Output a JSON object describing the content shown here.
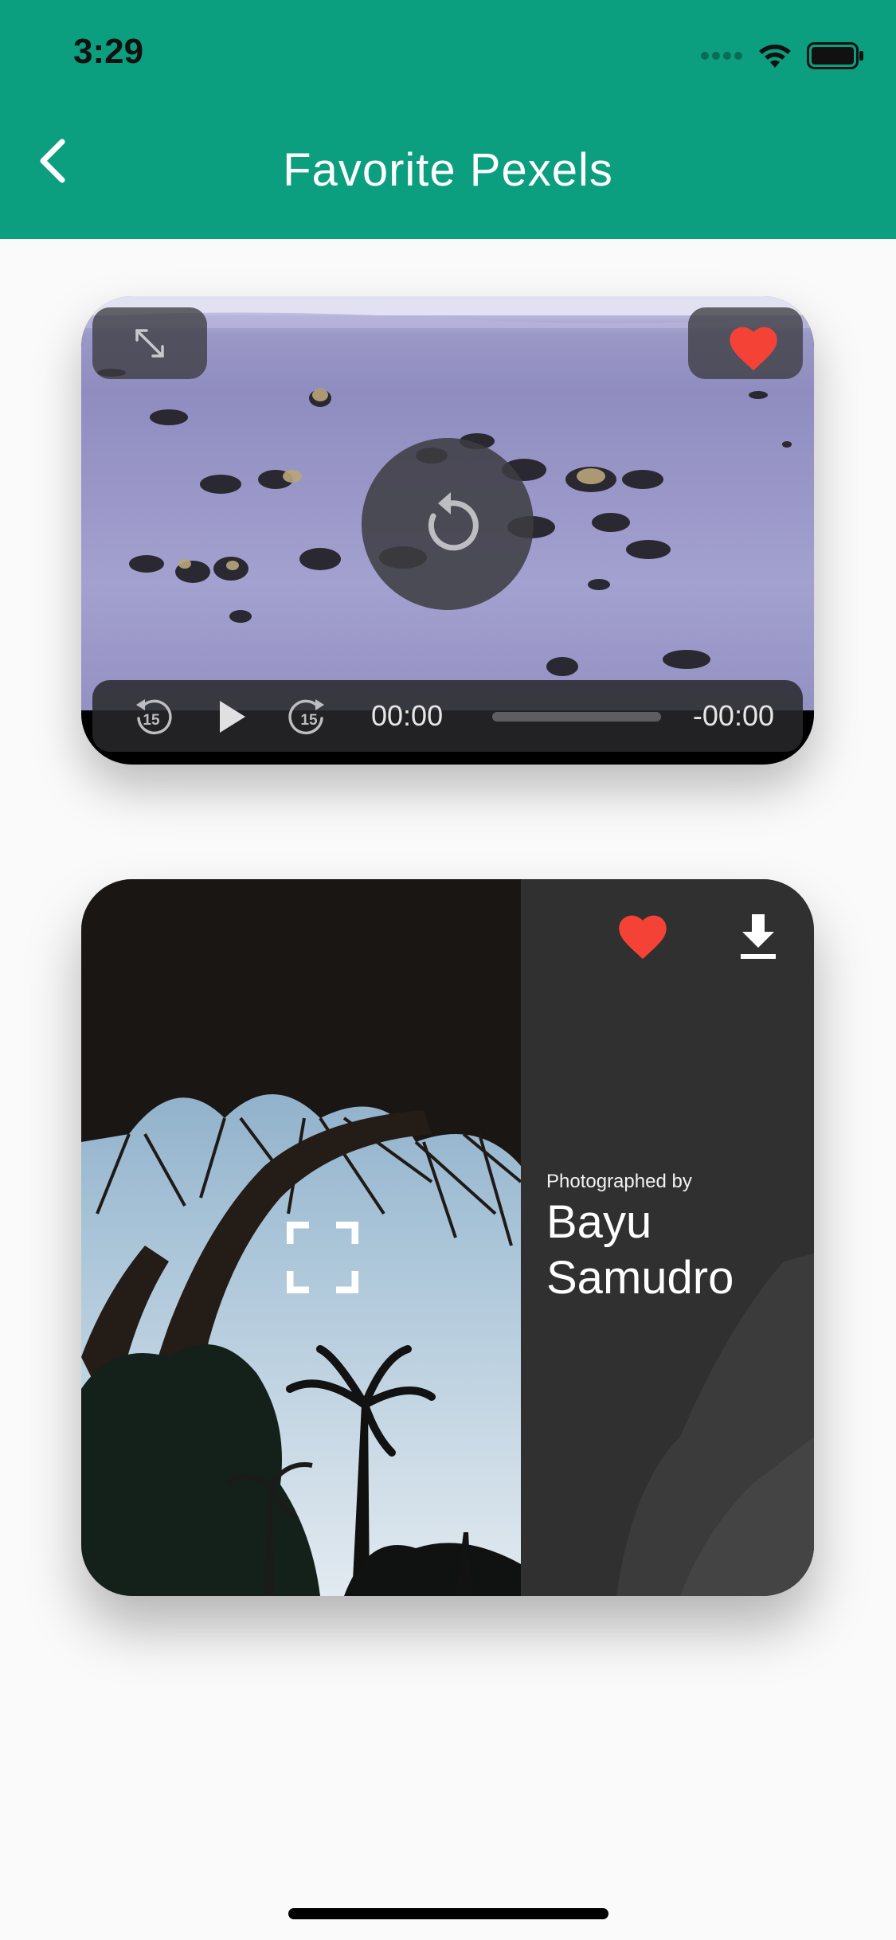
{
  "status_bar": {
    "time": "3:29"
  },
  "app_bar": {
    "title": "Favorite Pexels"
  },
  "video_card": {
    "current_time": "00:00",
    "remaining_time": "-00:00",
    "skip_back_label": "15",
    "skip_forward_label": "15",
    "progress": 0,
    "favorited": true
  },
  "photo_card": {
    "photographed_by_label": "Photographed by",
    "photographer_name": "Bayu Samudro",
    "favorited": true
  },
  "colors": {
    "app_bar": "#0b9e7f",
    "heart": "#f44336",
    "panel": "#303030"
  }
}
